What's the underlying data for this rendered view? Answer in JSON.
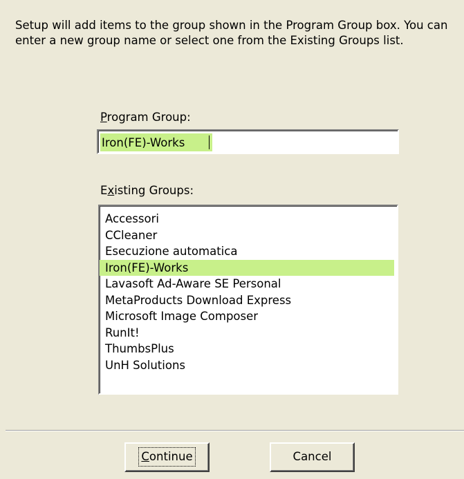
{
  "dialog": {
    "intro_text": "Setup will add items to the group shown in the Program Group box. You can enter a new group name or select one from the Existing Groups list.",
    "program_group": {
      "label_access_key": "P",
      "label_rest": "rogram Group:",
      "value": "Iron(FE)-Works"
    },
    "existing_groups": {
      "label_first": "E",
      "label_access_key": "x",
      "label_rest": "isting Groups:",
      "items": [
        "Accessori",
        "CCleaner",
        "Esecuzione automatica",
        "Iron(FE)-Works",
        "Lavasoft Ad-Aware SE Personal",
        "MetaProducts Download Express",
        "Microsoft Image Composer",
        "RunIt!",
        "ThumbsPlus",
        "UnH Solutions"
      ],
      "selected": "Iron(FE)-Works"
    },
    "buttons": {
      "continue_access_key": "C",
      "continue_rest": "ontinue",
      "cancel_label": "Cancel"
    },
    "colors": {
      "background": "#ece9d8",
      "highlight": "#c8f08a"
    }
  }
}
